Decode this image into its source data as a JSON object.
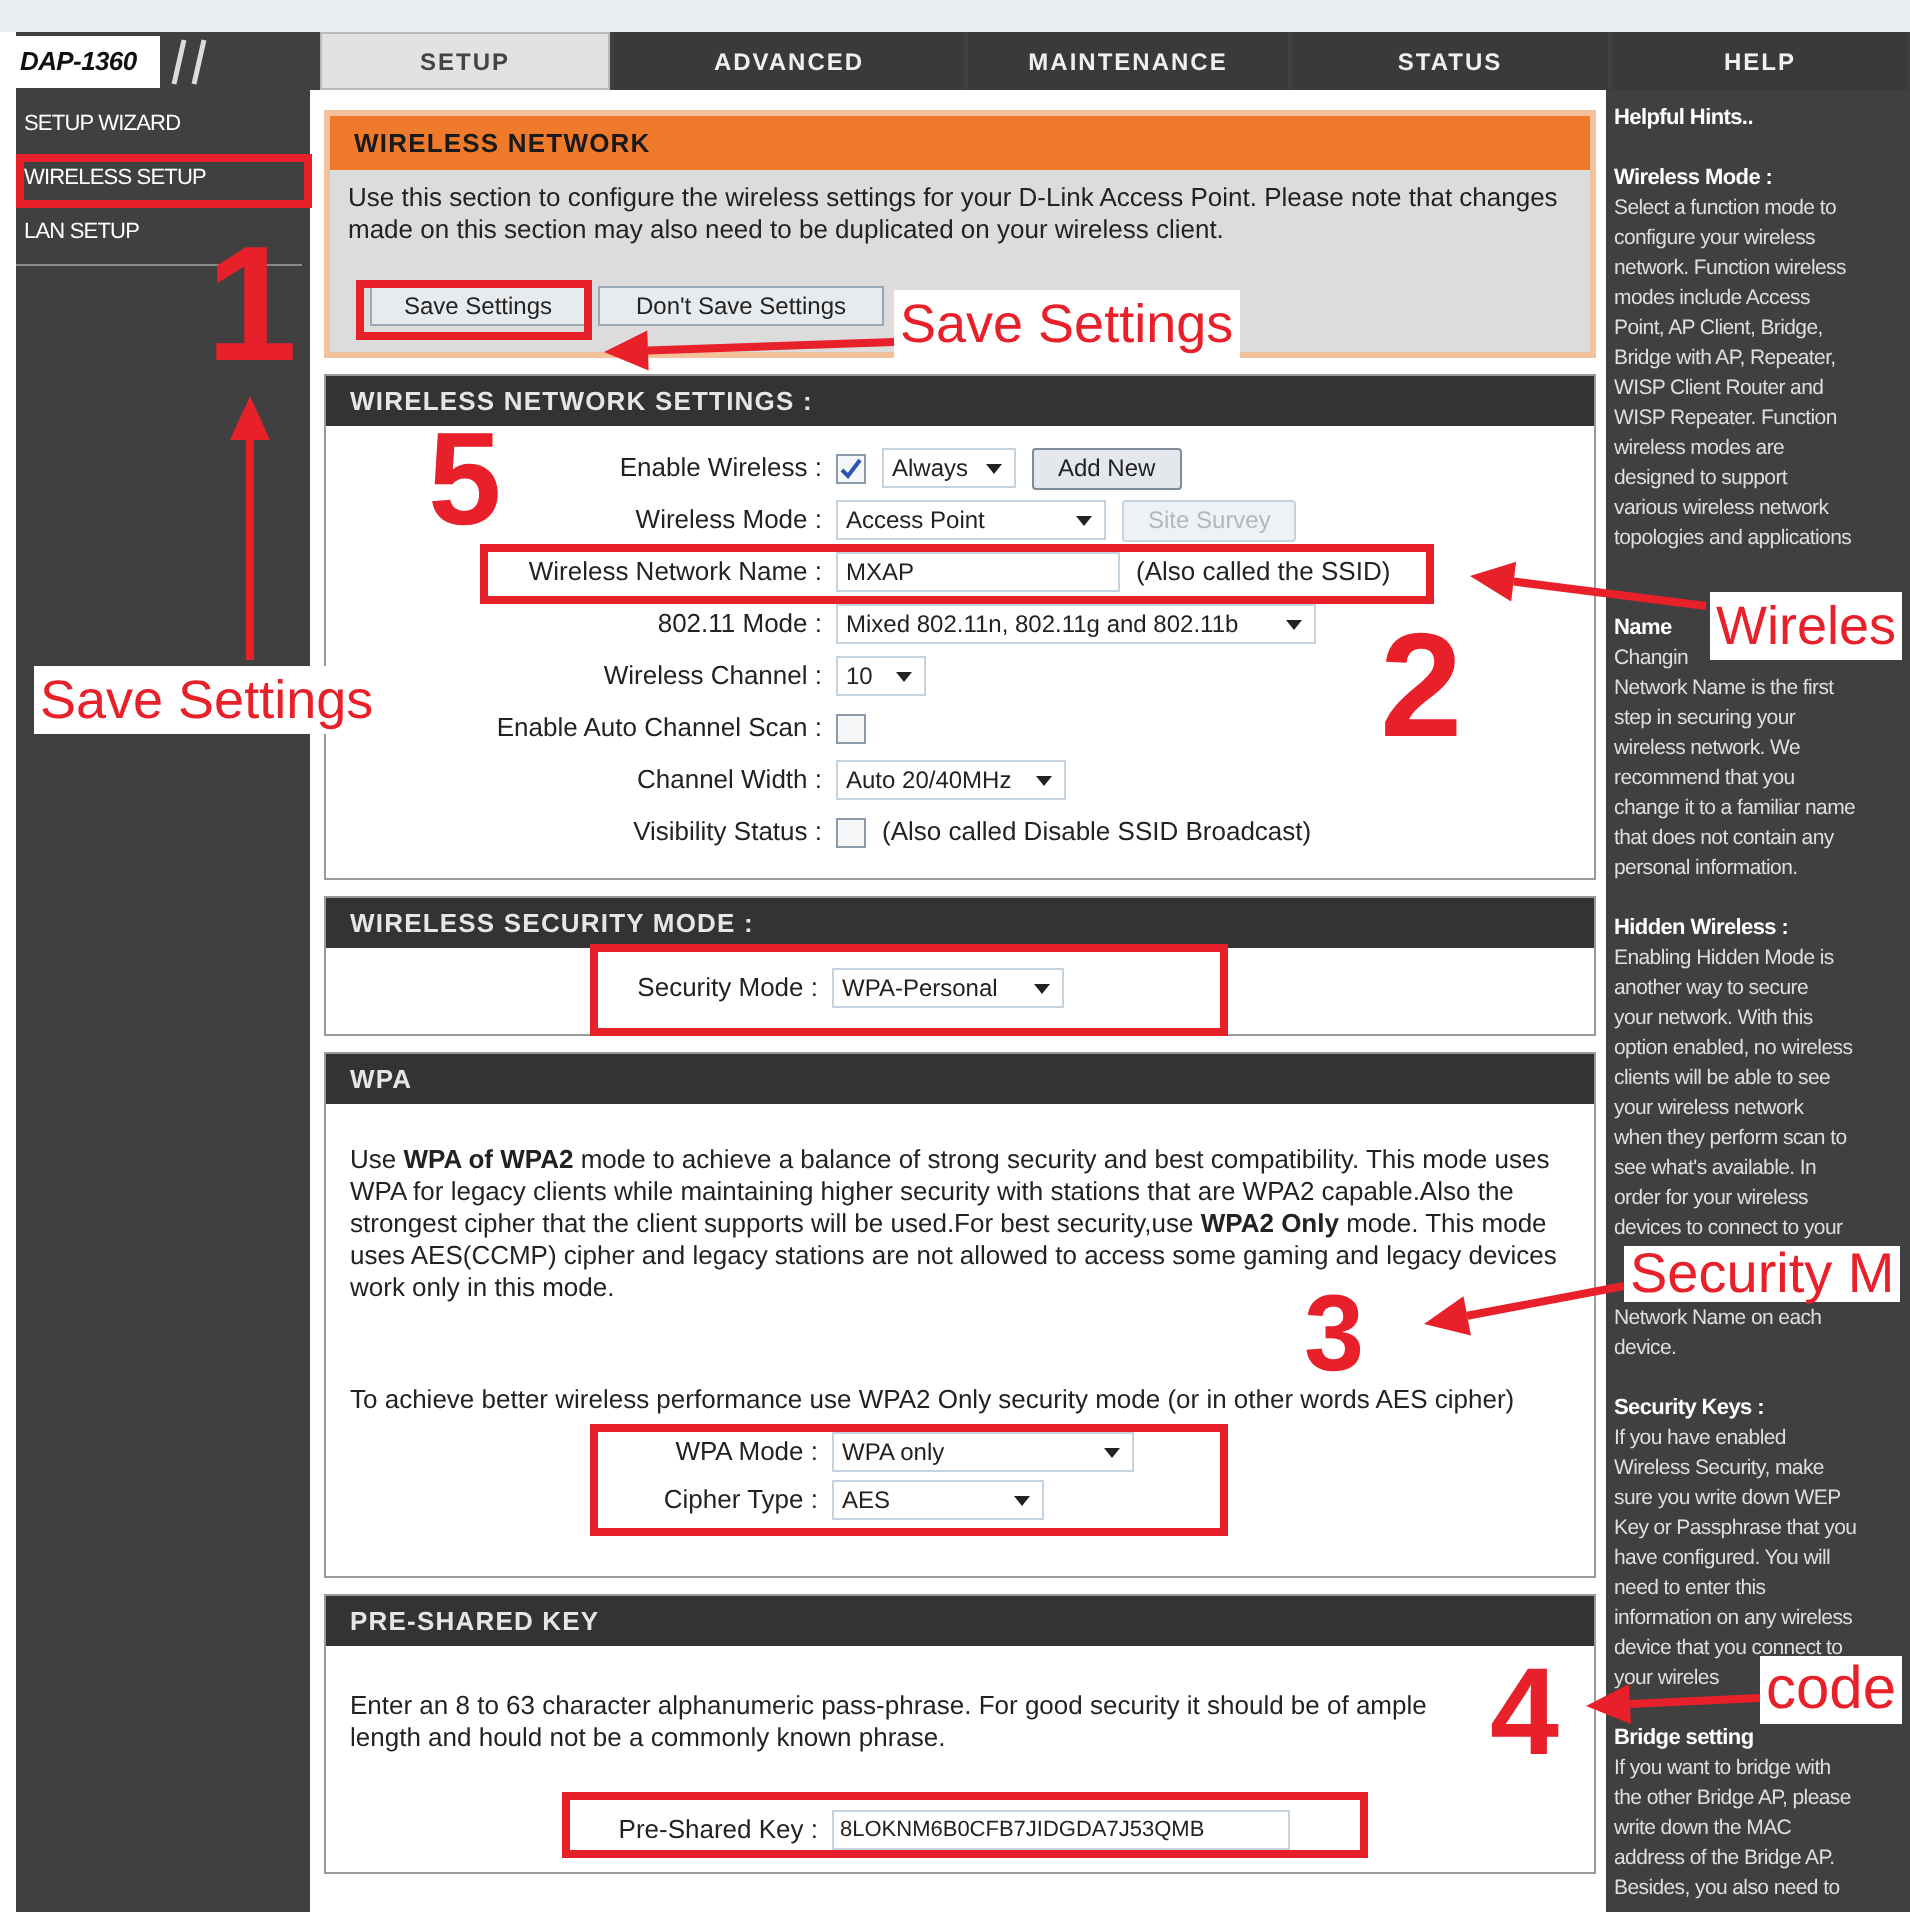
{
  "logo": {
    "text": "DAP-1360"
  },
  "tabs": [
    {
      "label": "SETUP",
      "selected": true
    },
    {
      "label": "ADVANCED",
      "selected": false
    },
    {
      "label": "MAINTENANCE",
      "selected": false
    },
    {
      "label": "STATUS",
      "selected": false
    },
    {
      "label": "HELP",
      "selected": false
    }
  ],
  "sidebar": {
    "items": [
      "SETUP WIZARD",
      "WIRELESS SETUP",
      "LAN SETUP"
    ]
  },
  "wireless_network": {
    "title": "WIRELESS NETWORK",
    "description": "Use this section to configure the wireless settings for your D-Link Access Point. Please note that changes made on this section may also need to be duplicated on your wireless client.",
    "buttons": [
      "Save Settings",
      "Don't Save Settings"
    ]
  },
  "wireless_settings": {
    "title": "WIRELESS NETWORK SETTINGS :",
    "rows": [
      {
        "label": "Enable Wireless :",
        "controls": [
          {
            "kind": "checkbox",
            "checked": true
          },
          {
            "kind": "select",
            "value": "Always"
          },
          {
            "kind": "button",
            "label": "Add New",
            "disabled": false
          }
        ]
      },
      {
        "label": "Wireless Mode :",
        "controls": [
          {
            "kind": "select",
            "value": "Access Point"
          },
          {
            "kind": "button",
            "label": "Site Survey",
            "disabled": true
          }
        ]
      },
      {
        "label": "Wireless Network Name :",
        "controls": [
          {
            "kind": "input",
            "value": "MXAP"
          },
          {
            "kind": "note",
            "text": "(Also called the SSID)"
          }
        ]
      },
      {
        "label": "802.11 Mode :",
        "controls": [
          {
            "kind": "select",
            "value": "Mixed 802.11n, 802.11g and 802.11b"
          }
        ]
      },
      {
        "label": "Wireless Channel :",
        "controls": [
          {
            "kind": "select",
            "value": "10"
          }
        ]
      },
      {
        "label": "Enable Auto Channel Scan :",
        "controls": [
          {
            "kind": "checkbox",
            "checked": false
          }
        ]
      },
      {
        "label": "Channel Width :",
        "controls": [
          {
            "kind": "select",
            "value": "Auto 20/40MHz"
          }
        ]
      },
      {
        "label": "Visibility Status :",
        "controls": [
          {
            "kind": "checkbox",
            "checked": false
          },
          {
            "kind": "note",
            "text": "(Also called Disable SSID Broadcast)"
          }
        ]
      }
    ]
  },
  "security_mode": {
    "title": "WIRELESS SECURITY MODE :",
    "label": "Security Mode :",
    "value": "WPA-Personal"
  },
  "wpa": {
    "title": "WPA",
    "paragraphs": [
      "Use **WPA of WPA2** mode to achieve a balance of strong security and best compatibility. This mode uses WPA for legacy clients while maintaining higher security with stations that are WPA2 capable.Also the strongest cipher that the client supports will be used.For best security,use **WPA2 Only** mode. This mode uses AES(CCMP) cipher and legacy stations are not allowed to access some gaming and legacy devices work only in this mode.",
      "To achieve better wireless performance use WPA2 Only security mode (or in other words AES cipher)"
    ],
    "rows": [
      {
        "label": "WPA Mode :",
        "value": "WPA only"
      },
      {
        "label": "Cipher Type :",
        "value": "AES"
      }
    ]
  },
  "pre_shared_key": {
    "title": "PRE-SHARED KEY",
    "description": "Enter an 8 to 63 character alphanumeric pass-phrase. For good security it should be of ample length and hould not be a commonly known phrase.",
    "label": "Pre-Shared Key :",
    "value": "8LOKNM6B0CFB7JIDGDA7J53QMB"
  },
  "help": {
    "sections": [
      {
        "title": "Helpful Hints.."
      },
      {
        "title": "Wireless Mode :",
        "lines": [
          "Select a function mode to",
          "configure your wireless",
          "network. Function wireless",
          "modes include Access",
          "Point, AP Client, Bridge,",
          "Bridge with AP, Repeater,",
          "WISP Client Router and",
          "WISP Repeater. Function",
          "wireless modes are",
          "designed to support",
          "various wireless network",
          "topologies and applications"
        ]
      },
      {
        "title": "Name",
        "lines": [
          "Changin",
          "Network Name is the first",
          "step in securing your",
          "wireless network. We",
          "recommend that you",
          "change it to a familiar name",
          "that does not contain any",
          "personal information."
        ]
      },
      {
        "title": "Hidden Wireless :",
        "lines": [
          "Enabling Hidden Mode is",
          "another way to secure",
          "your network. With this",
          "option enabled, no wireless",
          "clients will be able to see",
          "your wireless network",
          "when they perform scan to",
          "see what's available. In",
          "order for your wireless",
          "devices to connect to your"
        ]
      },
      {
        "lines": [
          "Network Name on each",
          "device."
        ]
      },
      {
        "title": "Security Keys :",
        "lines": [
          "If you have enabled",
          "Wireless Security, make",
          "sure you write down WEP",
          "Key or Passphrase that you",
          "have configured. You will",
          "need to enter this",
          "information on any wireless",
          "device that you connect to",
          "your wireles"
        ]
      },
      {
        "title": "Bridge setting",
        "lines": [
          "If you want to bridge with",
          "the other Bridge AP, please",
          "write down the MAC",
          "address of the Bridge AP.",
          "Besides, you also need to"
        ]
      }
    ]
  },
  "annotations": {
    "numbers": [
      "1",
      "5",
      "2",
      "3",
      "4"
    ],
    "callouts": [
      "Save Settings",
      "Save Settings",
      "Wireles",
      "Security M",
      "code"
    ]
  }
}
